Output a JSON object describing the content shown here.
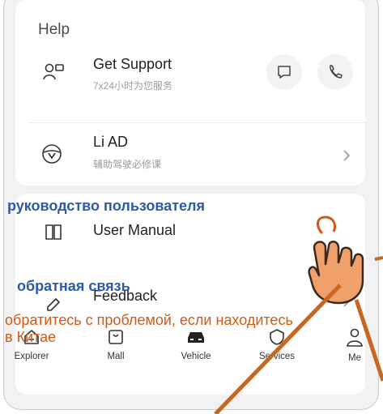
{
  "help": {
    "title": "Help",
    "support": {
      "title": "Get Support",
      "subtitle": "7x24小时为您服务"
    },
    "li_ad": {
      "title": "Li AD",
      "subtitle": "辅助驾驶必修课"
    }
  },
  "manual": {
    "user_manual": {
      "title": "User Manual"
    },
    "feedback": {
      "title": "Feedback"
    }
  },
  "annotations": {
    "user_manual_ru": "руководство пользователя",
    "feedback_ru": "обратная связь",
    "feedback_note_ru": "обратитесь с проблемой, если находитесь в Китае"
  },
  "tabs": [
    {
      "label": "Explorer",
      "icon": "home-icon"
    },
    {
      "label": "Mall",
      "icon": "mall-bag-icon"
    },
    {
      "label": "Vehicle",
      "icon": "car-icon"
    },
    {
      "label": "Services",
      "icon": "services-shield-icon"
    },
    {
      "label": "Me",
      "icon": "person-icon"
    }
  ],
  "colors": {
    "annotation_blue": "#2d5aa8",
    "annotation_orange": "#d35a14",
    "hand_skin": "#f0a06a"
  }
}
